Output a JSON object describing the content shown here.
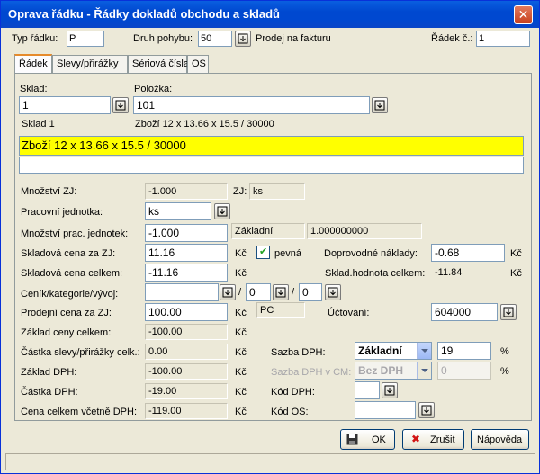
{
  "window": {
    "title": "Oprava řádku - Řádky dokladů obchodu a skladů",
    "close": "✕"
  },
  "header": {
    "typ_label": "Typ řádku:",
    "typ_value": "P",
    "druh_label": "Druh pohybu:",
    "druh_value": "50",
    "druh_text": "Prodej na fakturu",
    "radek_label": "Řádek č.:",
    "radek_value": "1"
  },
  "tabs": [
    {
      "label": "Řádek",
      "active": true
    },
    {
      "label": "Slevy/přirážky"
    },
    {
      "label": "Sériová čísla"
    },
    {
      "label": "OS"
    }
  ],
  "form": {
    "sklad_label": "Sklad:",
    "sklad_value": "1",
    "sklad_name": "Sklad 1",
    "polozka_label": "Položka:",
    "polozka_value": "101",
    "polozka_name": "Zboží 12 x 13.66 x 15.5 / 30000",
    "description": "Zboží 12 x 13.66 x 15.5 / 30000",
    "mnozstvi_zj_label": "Množství ZJ:",
    "mnozstvi_zj": "-1.000",
    "zj_label": "ZJ:",
    "zj_value": "ks",
    "prac_jednotka_label": "Pracovní jednotka:",
    "prac_jednotka": "ks",
    "mnozstvi_prac_label": "Množství prac. jednotek:",
    "mnozstvi_prac": "-1.000",
    "zakladni_label": "Základní",
    "zakladni_koef": "1.000000000",
    "skl_cena_zj_label": "Skladová cena za ZJ:",
    "skl_cena_zj": "11.16",
    "kc1": "Kč",
    "pevna_label": "pevná",
    "pevna_checked": "✔",
    "doprovodne_label": "Doprovodné náklady:",
    "doprovodne": "-0.68",
    "kc_dopr": "Kč",
    "skl_cena_celkem_label": "Skladová cena celkem:",
    "skl_cena_celkem": "-11.16",
    "kc2": "Kč",
    "skl_hodnota_label": "Sklad.hodnota celkem:",
    "skl_hodnota": "-11.84",
    "kc_hodn": "Kč",
    "cenik_label": "Ceník/kategorie/vývoj:",
    "cenik_value": "",
    "kategorie_value": "0",
    "vyvoj_value": "0",
    "slash": "/",
    "prodejni_cena_label": "Prodejní cena za ZJ:",
    "prodejni_cena": "100.00",
    "kc3": "Kč",
    "pc_value": "PC",
    "uctovani_label": "Účtování:",
    "uctovani": "604000",
    "zaklad_ceny_label": "Základ ceny celkem:",
    "zaklad_ceny": "-100.00",
    "kc4": "Kč",
    "castka_slevy_label": "Částka slevy/přirážky celk.:",
    "castka_slevy": "0.00",
    "kc5": "Kč",
    "sazba_dph_label": "Sazba DPH:",
    "sazba_dph": "Základní",
    "sazba_pct": "19",
    "pct": "%",
    "zaklad_dph_label": "Základ DPH:",
    "zaklad_dph": "-100.00",
    "kc6": "Kč",
    "sazba_cm_label": "Sazba DPH v CM:",
    "sazba_cm": "Bez DPH",
    "sazba_cm_pct": "0",
    "pct2": "%",
    "castka_dph_label": "Částka DPH:",
    "castka_dph": "-19.00",
    "kc7": "Kč",
    "kod_dph_label": "Kód DPH:",
    "kod_dph": "",
    "cena_celkem_label": "Cena celkem včetně DPH:",
    "cena_celkem": "-119.00",
    "kc8": "Kč",
    "kod_os_label": "Kód OS:",
    "kod_os": ""
  },
  "buttons": {
    "ok": "OK",
    "zrusit": "Zrušit",
    "napoveda": "Nápověda"
  },
  "colors": {
    "title_bar": "#0054e3",
    "highlight": "#ffff00",
    "active_tab": "#e68b2c"
  }
}
